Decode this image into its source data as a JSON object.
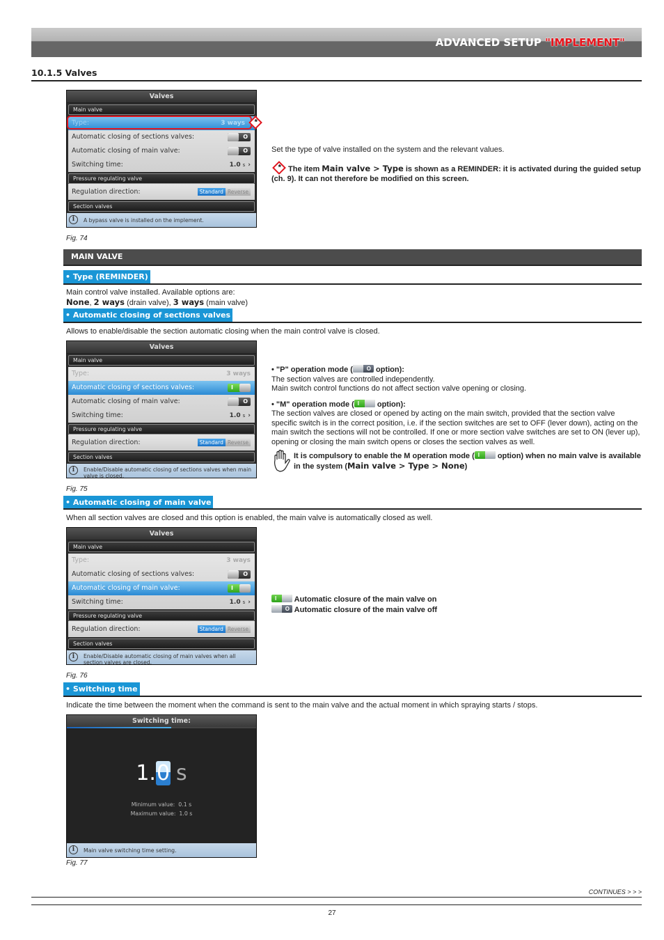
{
  "header": {
    "title_prefix": "ADVANCED SETUP ",
    "title_accent": "\"IMPLEMENT\"",
    "accent_color": "#e8141c"
  },
  "section": {
    "number_title": "10.1.5   Valves"
  },
  "figures": {
    "fig74": {
      "caption": "Fig. 74",
      "screen_title": "Valves",
      "group_main": "Main valve",
      "type_label": "Type:",
      "type_value": "3 ways",
      "auto_sections_label": "Automatic closing of sections valves:",
      "auto_sections_state": "off",
      "auto_main_label": "Automatic closing of main valve:",
      "auto_main_state": "off",
      "switching_label": "Switching time:",
      "switching_value": "1.0",
      "switching_unit": "s",
      "group_pressure": "Pressure regulating valve",
      "regulation_label": "Regulation direction:",
      "regulation_options": [
        "Standard",
        "Reverse"
      ],
      "regulation_selected": "Standard",
      "group_sections": "Section valves",
      "info": "A bypass valve is installed on the implement."
    },
    "fig75": {
      "caption": "Fig. 75",
      "screen_title": "Valves",
      "group_main": "Main valve",
      "type_label": "Type:",
      "type_value": "3 ways",
      "auto_sections_label": "Automatic closing of sections valves:",
      "auto_sections_state": "on",
      "auto_main_label": "Automatic closing of main valve:",
      "auto_main_state": "off",
      "switching_label": "Switching time:",
      "switching_value": "1.0",
      "switching_unit": "s",
      "group_pressure": "Pressure regulating valve",
      "regulation_label": "Regulation direction:",
      "regulation_options": [
        "Standard",
        "Reverse"
      ],
      "regulation_selected": "Standard",
      "group_sections": "Section valves",
      "info": "Enable/Disable automatic closing of sections valves when main valve is closed."
    },
    "fig76": {
      "caption": "Fig. 76",
      "screen_title": "Valves",
      "group_main": "Main valve",
      "type_label": "Type:",
      "type_value": "3 ways",
      "auto_sections_label": "Automatic closing of sections valves:",
      "auto_sections_state": "off",
      "auto_main_label": "Automatic closing of main valve:",
      "auto_main_state": "on",
      "switching_label": "Switching time:",
      "switching_value": "1.0",
      "switching_unit": "s",
      "group_pressure": "Pressure regulating valve",
      "regulation_label": "Regulation direction:",
      "regulation_options": [
        "Standard",
        "Reverse"
      ],
      "regulation_selected": "Standard",
      "group_sections": "Section valves",
      "info": "Enable/Disable automatic closing of main valves when all section valves are closed."
    },
    "fig77": {
      "caption": "Fig. 77",
      "screen_title": "Switching time:",
      "progress_fraction": 0.55,
      "value_int": "1.",
      "value_digit": "0",
      "value_unit": "s",
      "min_label": "Minimum value:",
      "min_value": "0.1 s",
      "max_label": "Maximum value:",
      "max_value": "1.0 s",
      "info": "Main valve switching time setting."
    }
  },
  "intro": {
    "text": "Set the type of valve installed on the system and the relevant values.",
    "reminder_pre": "The item ",
    "reminder_ui": "Main valve > Type",
    "reminder_post": " is shown as a REMINDER: it is activated during the guided setup (ch. 9). It can not therefore be modified on this screen.",
    "reminder_symbol": "*"
  },
  "main_valve": {
    "bar_title": "MAIN VALVE",
    "type": {
      "tab": "• Type (REMINDER)",
      "line1": "Main control valve installed. Available options are:",
      "opt_none": "None",
      "sep1": ", ",
      "opt_2": "2 ways",
      "desc_2": " (drain valve), ",
      "opt_3": "3 ways",
      "desc_3": " (main valve)"
    },
    "auto_sections": {
      "tab": "• Automatic closing of sections valves",
      "text": "Allows to enable/disable the section automatic closing when the main control valve is closed.",
      "p_title_pre": "• \"P\" operation mode (",
      "p_title_post": " option):",
      "p_line1": "The section valves are controlled independently.",
      "p_line2": "Main switch control functions do not affect section valve opening or closing.",
      "m_title_pre": "• \"M\" operation mode (",
      "m_title_post": " option):",
      "m_text": "The section valves are closed or opened by acting on the main switch, provided that the section valve specific switch is in the correct position, i.e. if the section switches are set to OFF (lever down), acting on the main switch the sections will not be controlled. If one or more section valve switches are set to ON (lever up), opening or closing the main switch opens or closes the section valves as well.",
      "note_pre": "It is compulsory to enable the M operation mode (",
      "note_mid": " option) when no main valve is available in the system (",
      "note_ui": "Main valve > Type > None",
      "note_post": ")"
    },
    "auto_main": {
      "tab": "• Automatic closing of main valve",
      "text": "When all section valves are closed and this option is enabled, the main valve is automatically closed as well.",
      "legend_on": "Automatic closure of the main valve on",
      "legend_off": "Automatic closure of the main valve off"
    },
    "switching": {
      "tab": "• Switching time",
      "text": "Indicate the time between the moment when the command is sent to the main valve and the actual moment in which spraying starts / stops."
    }
  },
  "footer": {
    "continues": "CONTINUES > > >",
    "page_number": "27"
  }
}
